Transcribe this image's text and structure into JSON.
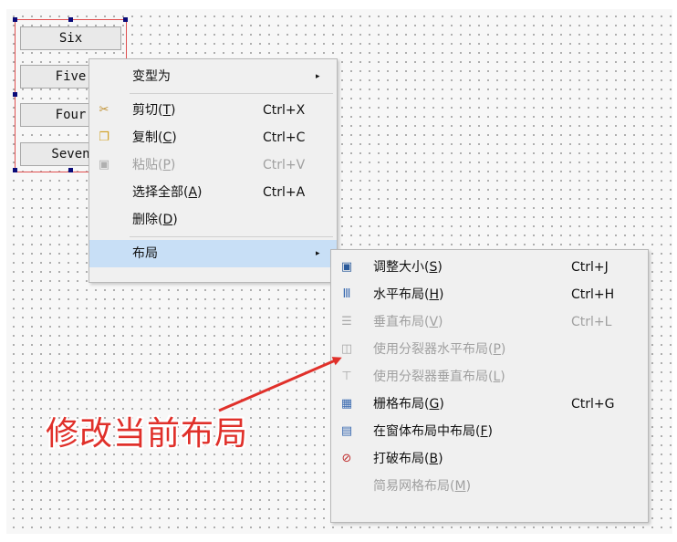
{
  "form_buttons": [
    "Six",
    "Five",
    "Four",
    "Seven"
  ],
  "context_menu": {
    "items": [
      {
        "label": "变型为",
        "arrow": "▸"
      },
      {
        "label": "剪切",
        "mnemonic": "T",
        "shortcut": "Ctrl+X",
        "icon": "scissors-icon"
      },
      {
        "label": "复制",
        "mnemonic": "C",
        "shortcut": "Ctrl+C",
        "icon": "copy-icon"
      },
      {
        "label": "粘贴",
        "mnemonic": "P",
        "shortcut": "Ctrl+V",
        "icon": "paste-icon",
        "disabled": true
      },
      {
        "label": "选择全部",
        "mnemonic": "A",
        "shortcut": "Ctrl+A"
      },
      {
        "label": "删除",
        "mnemonic": "D"
      },
      {
        "label": "布局",
        "arrow": "▸",
        "highlighted": true
      }
    ]
  },
  "layout_submenu": {
    "items": [
      {
        "label": "调整大小",
        "mnemonic": "S",
        "shortcut": "Ctrl+J",
        "icon": "adjust-size-icon"
      },
      {
        "label": "水平布局",
        "mnemonic": "H",
        "shortcut": "Ctrl+H",
        "icon": "horizontal-layout-icon"
      },
      {
        "label": "垂直布局",
        "mnemonic": "V",
        "shortcut": "Ctrl+L",
        "icon": "vertical-layout-icon",
        "disabled": true
      },
      {
        "label": "使用分裂器水平布局",
        "mnemonic": "P",
        "icon": "horizontal-splitter-icon",
        "disabled": true
      },
      {
        "label": "使用分裂器垂直布局",
        "mnemonic": "L",
        "icon": "vertical-splitter-icon",
        "disabled": true
      },
      {
        "label": "栅格布局",
        "mnemonic": "G",
        "shortcut": "Ctrl+G",
        "icon": "grid-layout-icon"
      },
      {
        "label": "在窗体布局中布局",
        "mnemonic": "F",
        "icon": "form-layout-icon"
      },
      {
        "label": "打破布局",
        "mnemonic": "B",
        "icon": "break-layout-icon"
      },
      {
        "label": "简易网格布局",
        "mnemonic": "M",
        "disabled": true
      }
    ]
  },
  "annotation": {
    "text": "修改当前布局",
    "color": "#e0302a"
  }
}
